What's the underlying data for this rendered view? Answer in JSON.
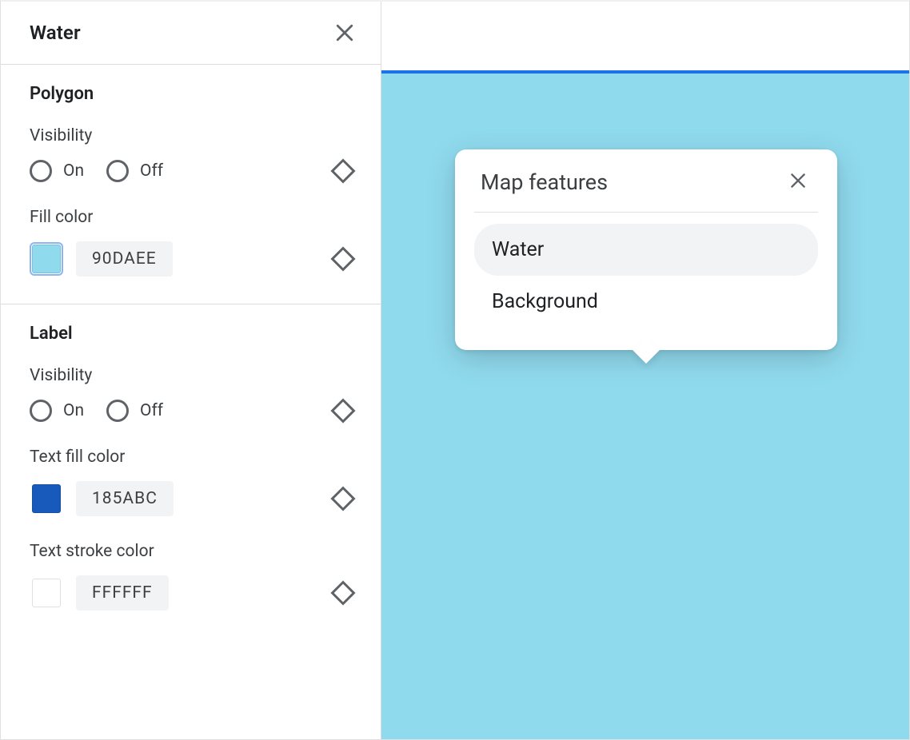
{
  "panel": {
    "title": "Water",
    "sections": {
      "polygon": {
        "title": "Polygon",
        "visibility_label": "Visibility",
        "on_label": "On",
        "off_label": "Off",
        "fill_color_label": "Fill color",
        "fill_color_hex": "90DAEE",
        "fill_color_css": "#90DAEE"
      },
      "label": {
        "title": "Label",
        "visibility_label": "Visibility",
        "on_label": "On",
        "off_label": "Off",
        "text_fill_label": "Text fill color",
        "text_fill_hex": "185ABC",
        "text_fill_css": "#185ABC",
        "text_stroke_label": "Text stroke color",
        "text_stroke_hex": "FFFFFF",
        "text_stroke_css": "#FFFFFF"
      }
    }
  },
  "preview": {
    "water_color": "#90DAEE",
    "accent_bar": "#1a73e8",
    "popover": {
      "title": "Map features",
      "items": [
        "Water",
        "Background"
      ],
      "selected_index": 0
    }
  }
}
